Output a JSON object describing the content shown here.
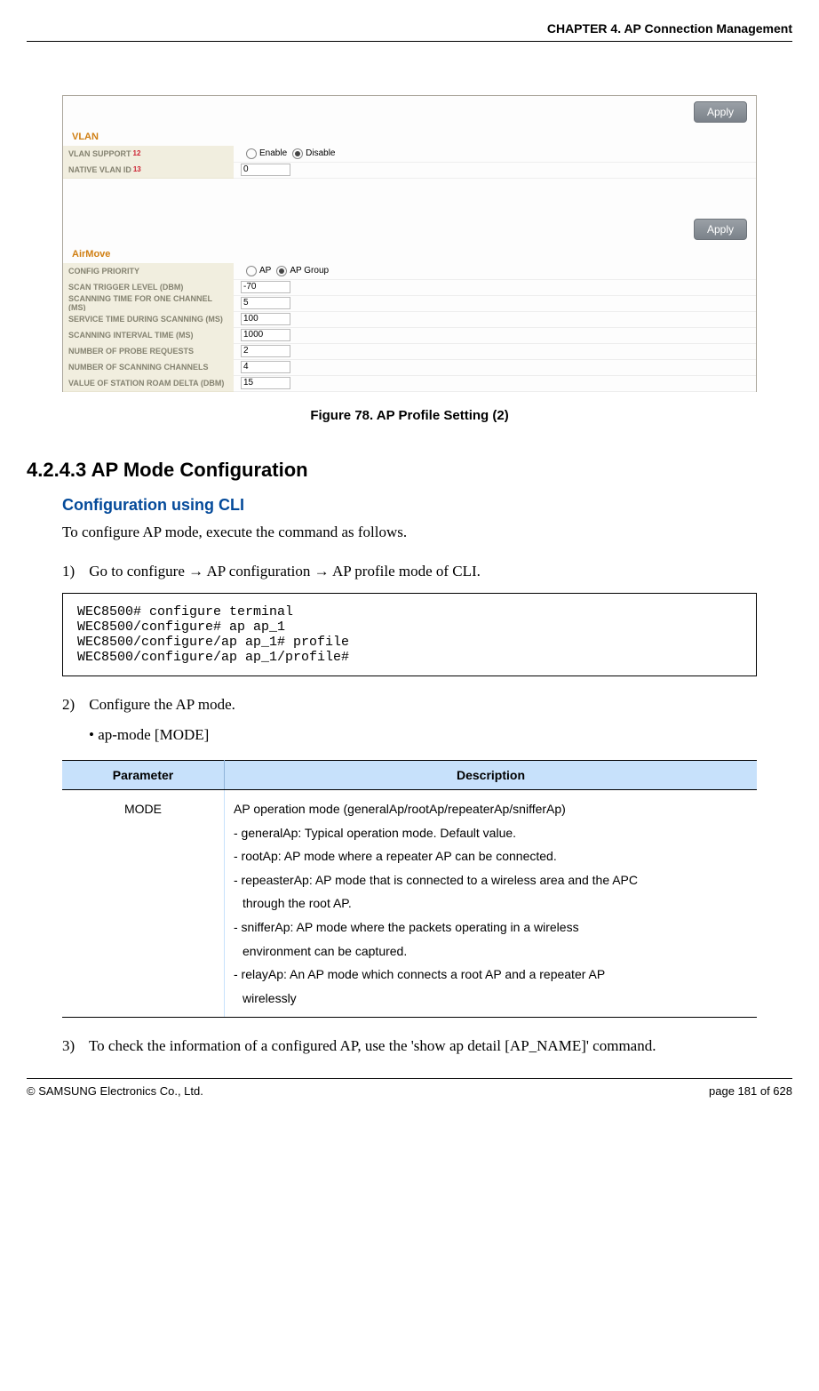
{
  "header": {
    "chapter": "CHAPTER 4. AP Connection Management"
  },
  "figure": {
    "apply": "Apply",
    "vlan": {
      "title": "VLAN",
      "support_label": "VLAN SUPPORT",
      "support_sup": "12",
      "enable": "Enable",
      "disable": "Disable",
      "native_label": "NATIVE VLAN ID",
      "native_sup": "13",
      "native_value": "0"
    },
    "airmove": {
      "title": "AirMove",
      "rows": [
        {
          "label": "CONFIG PRIORITY",
          "radio1": "AP",
          "radio2": "AP Group"
        },
        {
          "label": "SCAN TRIGGER LEVEL (DBM)",
          "value": "-70"
        },
        {
          "label": "SCANNING TIME FOR ONE CHANNEL (MS)",
          "value": "5"
        },
        {
          "label": "SERVICE TIME DURING SCANNING (MS)",
          "value": "100"
        },
        {
          "label": "SCANNING INTERVAL TIME (MS)",
          "value": "1000"
        },
        {
          "label": "NUMBER OF PROBE REQUESTS",
          "value": "2"
        },
        {
          "label": "NUMBER OF SCANNING CHANNELS",
          "value": "4"
        },
        {
          "label": "VALUE OF STATION ROAM DELTA (DBM)",
          "value": "15"
        }
      ]
    },
    "caption": "Figure 78. AP Profile Setting (2)"
  },
  "section": {
    "number_title": "4.2.4.3     AP Mode Configuration",
    "sub_title": "Configuration using CLI",
    "intro": "To configure AP mode, execute the command as follows.",
    "step1_num": "1)",
    "step1": "Go to configure → AP configuration → AP profile mode of CLI.",
    "code": "WEC8500# configure terminal\nWEC8500/configure# ap ap_1\nWEC8500/configure/ap ap_1# profile\nWEC8500/configure/ap ap_1/profile#",
    "step2_num": "2)",
    "step2": "Configure the AP mode.",
    "step2_bullet": "•  ap-mode [MODE]",
    "step3_num": "3)",
    "step3": "To check the information of a configured AP, use the 'show ap detail [AP_NAME]' command."
  },
  "table": {
    "h1": "Parameter",
    "h2": "Description",
    "param": "MODE",
    "desc_l1": "AP operation mode (generalAp/rootAp/repeaterAp/snifferAp)",
    "desc_l2": "- generalAp: Typical operation mode. Default value.",
    "desc_l3": "- rootAp: AP mode where a repeater AP can be connected.",
    "desc_l4a": "- repeasterAp: AP mode that is connected to a wireless area and the APC",
    "desc_l4b": "through the root AP.",
    "desc_l5a": "- snifferAp: AP mode where the packets operating in a wireless",
    "desc_l5b": "environment can be captured.",
    "desc_l6a": "- relayAp: An AP mode which connects a root AP and a repeater AP",
    "desc_l6b": "wirelessly"
  },
  "footer": {
    "left": "© SAMSUNG Electronics Co., Ltd.",
    "right": "page 181 of 628"
  }
}
